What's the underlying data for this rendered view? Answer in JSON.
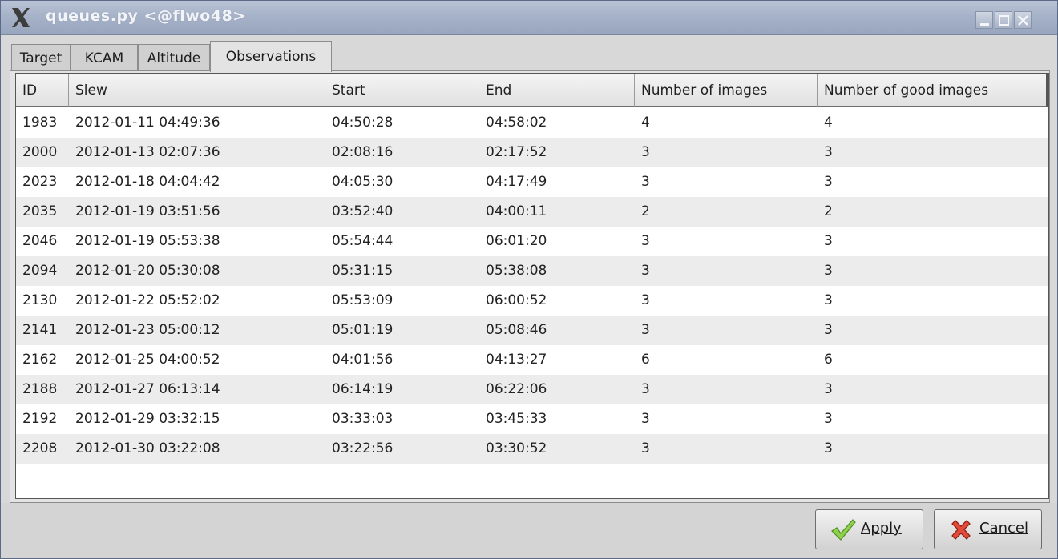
{
  "window": {
    "title": "queues.py <@flwo48>"
  },
  "tabs": [
    "Target",
    "KCAM",
    "Altitude",
    "Observations"
  ],
  "table": {
    "columns": [
      "ID",
      "Slew",
      "Start",
      "End",
      "Number of images",
      "Number of good images"
    ],
    "rows": [
      [
        "1983",
        "2012-01-11 04:49:36",
        "04:50:28",
        "04:58:02",
        "4",
        "4"
      ],
      [
        "2000",
        "2012-01-13 02:07:36",
        "02:08:16",
        "02:17:52",
        "3",
        "3"
      ],
      [
        "2023",
        "2012-01-18 04:04:42",
        "04:05:30",
        "04:17:49",
        "3",
        "3"
      ],
      [
        "2035",
        "2012-01-19 03:51:56",
        "03:52:40",
        "04:00:11",
        "2",
        "2"
      ],
      [
        "2046",
        "2012-01-19 05:53:38",
        "05:54:44",
        "06:01:20",
        "3",
        "3"
      ],
      [
        "2094",
        "2012-01-20 05:30:08",
        "05:31:15",
        "05:38:08",
        "3",
        "3"
      ],
      [
        "2130",
        "2012-01-22 05:52:02",
        "05:53:09",
        "06:00:52",
        "3",
        "3"
      ],
      [
        "2141",
        "2012-01-23 05:00:12",
        "05:01:19",
        "05:08:46",
        "3",
        "3"
      ],
      [
        "2162",
        "2012-01-25 04:00:52",
        "04:01:56",
        "04:13:27",
        "6",
        "6"
      ],
      [
        "2188",
        "2012-01-27 06:13:14",
        "06:14:19",
        "06:22:06",
        "3",
        "3"
      ],
      [
        "2192",
        "2012-01-29 03:32:15",
        "03:33:03",
        "03:45:33",
        "3",
        "3"
      ],
      [
        "2208",
        "2012-01-30 03:22:08",
        "03:22:56",
        "03:30:52",
        "3",
        "3"
      ]
    ]
  },
  "buttons": {
    "apply": "Apply",
    "cancel": "Cancel"
  }
}
